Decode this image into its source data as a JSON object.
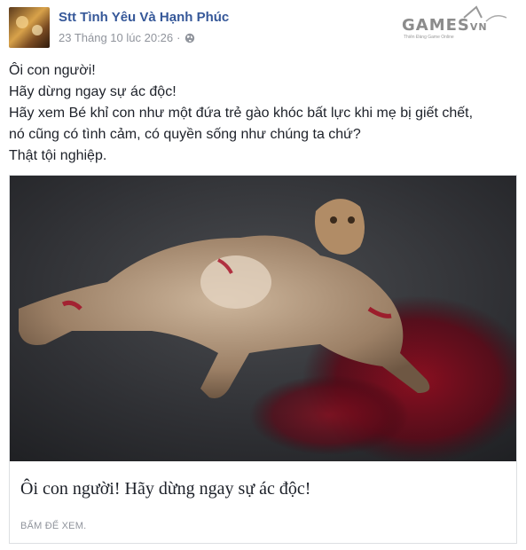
{
  "header": {
    "page_name": "Stt Tình Yêu Và Hạnh Phúc",
    "timestamp": "23 Tháng 10 lúc 20:26",
    "separator": "·",
    "privacy_icon": "globe-icon"
  },
  "watermark": {
    "brand": "GAMES",
    "brand_suffix": "VN",
    "tagline": "Thiên Đàng Game Online"
  },
  "post": {
    "lines": [
      "Ôi con người!",
      "Hãy dừng ngay sự ác độc!",
      "Hãy xem Bé khỉ con như một đứa trẻ gào khóc bất lực khi mẹ bị giết chết,",
      "nó cũng có tình cảm, có quyền sống như chúng ta chứ?",
      "Thật tội nghiệp."
    ]
  },
  "link_card": {
    "title": "Ôi con người! Hãy dừng ngay sự ác độc!",
    "caption": "BẤM ĐỂ XEM."
  },
  "colors": {
    "link_blue": "#365899",
    "meta_gray": "#90949c",
    "text_dark": "#1d2129",
    "border": "#dddfe2"
  }
}
